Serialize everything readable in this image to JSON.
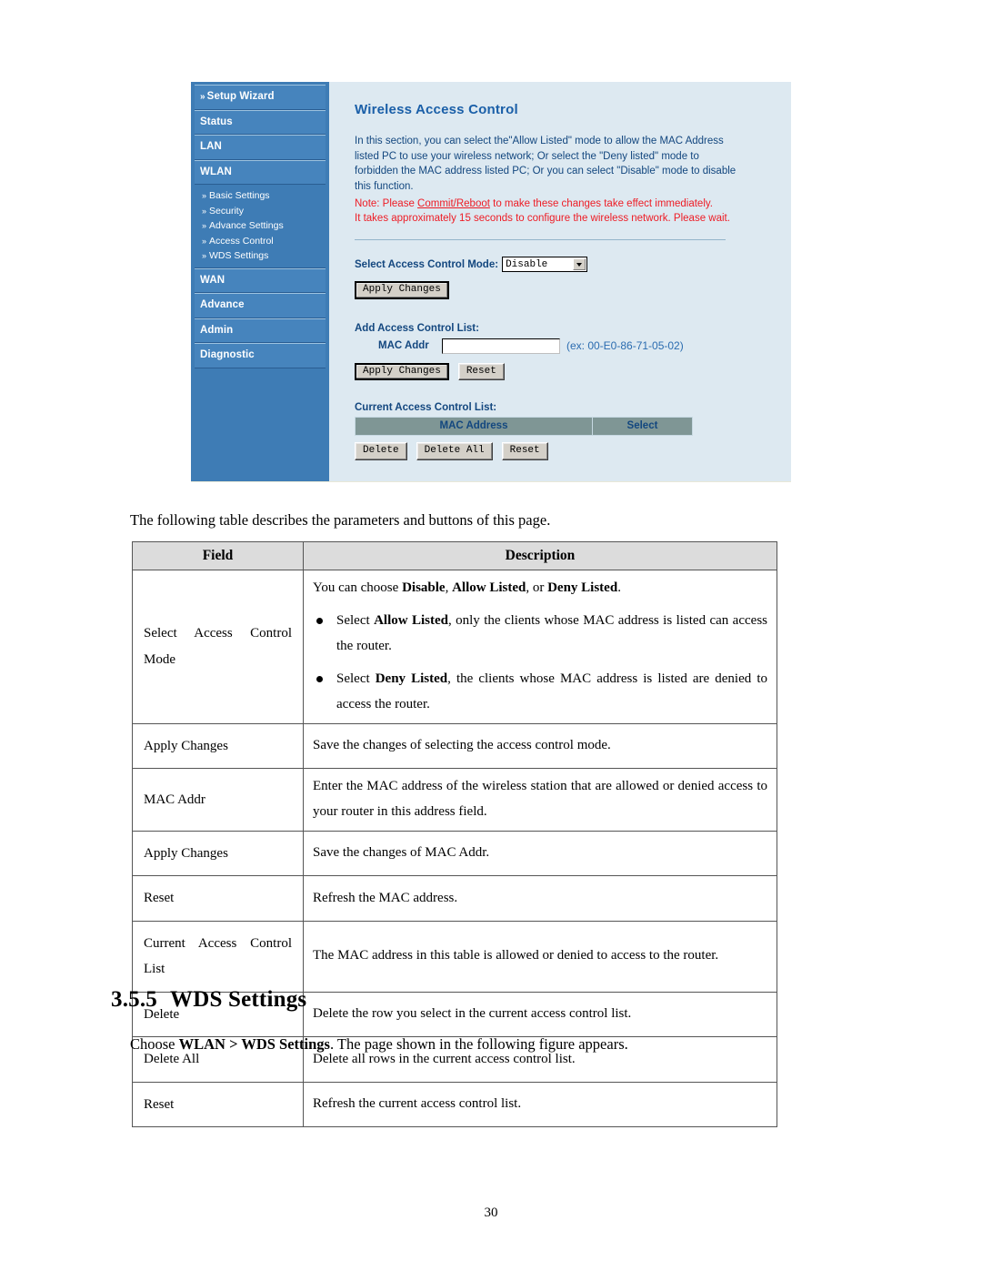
{
  "router_ui": {
    "sidebar": {
      "main_items": [
        {
          "label": "Setup Wizard",
          "chevron": "»",
          "has_chevron": true
        },
        {
          "label": "Status",
          "has_chevron": false
        },
        {
          "label": "LAN",
          "has_chevron": false
        },
        {
          "label": "WLAN",
          "has_chevron": false
        }
      ],
      "sub_items": [
        {
          "label": "Basic Settings",
          "chevron": "»"
        },
        {
          "label": "Security",
          "chevron": "»"
        },
        {
          "label": "Advance Settings",
          "chevron": "»"
        },
        {
          "label": "Access Control",
          "chevron": "»"
        },
        {
          "label": "WDS Settings",
          "chevron": "»"
        }
      ],
      "main_items_2": [
        {
          "label": "WAN"
        },
        {
          "label": "Advance"
        },
        {
          "label": "Admin"
        },
        {
          "label": "Diagnostic"
        }
      ]
    },
    "page_title": "Wireless Access Control",
    "intro_paragraph": "In this section, you can select the\"Allow Listed\" mode to allow the MAC Address listed PC to use your wireless network; Or select the \"Deny listed\" mode to forbidden the MAC address listed PC; Or you can select \"Disable\" mode to disable this function.",
    "note_prefix": "Note: Please ",
    "note_link": "Commit/Reboot",
    "note_suffix": " to make these changes take effect immediately.",
    "note_line2": "It takes approximately 15 seconds to configure the wireless network. Please wait.",
    "mode_label": "Select Access Control Mode:",
    "mode_value": "Disable",
    "apply_changes_1": "Apply Changes",
    "add_list_label": "Add Access Control List:",
    "mac_addr_label": "MAC Addr",
    "mac_addr_value": "",
    "mac_addr_hint": "(ex: 00-E0-86-71-05-02)",
    "apply_changes_2": "Apply Changes",
    "reset_1": "Reset",
    "current_list_label": "Current Access Control List:",
    "table_headers": [
      "MAC Address",
      "Select"
    ],
    "delete": "Delete",
    "delete_all": "Delete All",
    "reset_2": "Reset",
    "colors": {
      "sidebar_blue": "#3e7cb5",
      "nav_button_blue": "#4684bd",
      "content_bg": "#dde9f1",
      "heading_blue": "#1a5fa8",
      "note_red": "#ee1c25",
      "table_header_gray": "#7f9695"
    }
  },
  "document": {
    "intro_line": "The following table describes the parameters and buttons of this page.",
    "table": {
      "headers": [
        "Field",
        "Description"
      ],
      "rows": [
        {
          "field": "Select Access Control Mode",
          "desc_lead": "You can choose Disable, Allow Listed, or Deny Listed.",
          "bullets": [
            "Select Allow Listed, only the clients whose MAC address is listed can access the router.",
            "Select Deny Listed, the clients whose MAC address is listed are denied to access the router."
          ]
        },
        {
          "field": "Apply Changes",
          "desc": "Save the changes of selecting the access control mode."
        },
        {
          "field": "MAC Addr",
          "desc": "Enter the MAC address of the wireless station that are allowed or denied access to your router in this address field."
        },
        {
          "field": "Apply Changes",
          "desc": "Save the changes of MAC Addr."
        },
        {
          "field": "Reset",
          "desc": "Refresh the MAC address."
        },
        {
          "field": "Current Access Control List",
          "desc": "The MAC address in this table is allowed or denied to access to the router."
        },
        {
          "field": "Delete",
          "desc": "Delete the row you select in the current access control list."
        },
        {
          "field": "Delete All",
          "desc": "Delete all rows in the current access control list."
        },
        {
          "field": "Reset",
          "desc": "Refresh the current access control list."
        }
      ]
    },
    "section_number": "3.5.5",
    "section_title": "WDS Settings",
    "choose_line_prefix": "Choose ",
    "choose_line_bold": "WLAN > WDS Settings",
    "choose_line_suffix": ". The page shown in the following figure appears.",
    "page_number": "30"
  }
}
